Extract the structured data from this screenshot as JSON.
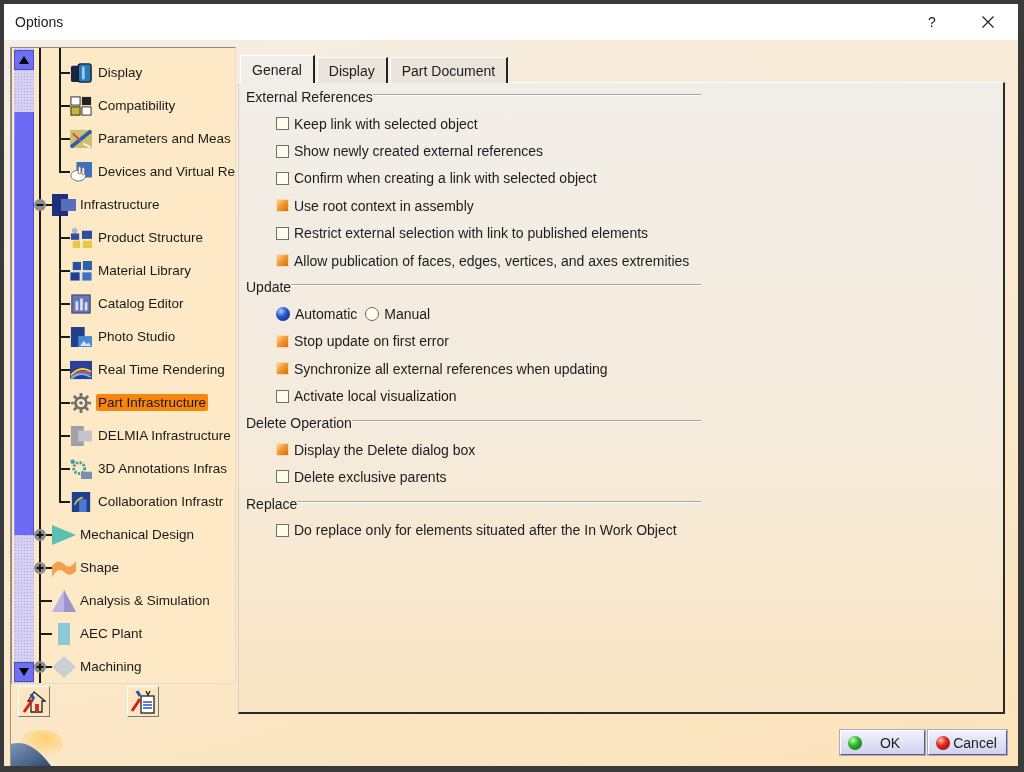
{
  "window": {
    "title": "Options",
    "help_button": "?"
  },
  "tree": {
    "scrolled_branch_children": [
      {
        "label": "Display",
        "selected": false
      },
      {
        "label": "Compatibility",
        "selected": false
      },
      {
        "label": "Parameters and Meas",
        "selected": false
      },
      {
        "label": "Devices and Virtual Re",
        "selected": false
      }
    ],
    "items": [
      {
        "label": "Infrastructure",
        "selected": false,
        "expanded": true,
        "children": [
          {
            "label": "Product Structure",
            "selected": false
          },
          {
            "label": "Material Library",
            "selected": false
          },
          {
            "label": "Catalog Editor",
            "selected": false
          },
          {
            "label": "Photo Studio",
            "selected": false
          },
          {
            "label": "Real Time Rendering",
            "selected": false
          },
          {
            "label": "Part Infrastructure",
            "selected": true
          },
          {
            "label": "DELMIA Infrastructure",
            "selected": false
          },
          {
            "label": "3D Annotations Infras",
            "selected": false
          },
          {
            "label": "Collaboration Infrastr",
            "selected": false
          }
        ]
      },
      {
        "label": "Mechanical Design",
        "selected": false,
        "expanded": false
      },
      {
        "label": "Shape",
        "selected": false,
        "expanded": false
      },
      {
        "label": "Analysis & Simulation",
        "selected": false
      },
      {
        "label": "AEC Plant",
        "selected": false
      },
      {
        "label": "Machining",
        "selected": false,
        "expanded": false
      }
    ]
  },
  "tabs": [
    {
      "label": "General",
      "selected": true
    },
    {
      "label": "Display",
      "selected": false
    },
    {
      "label": "Part Document",
      "selected": false
    }
  ],
  "groups": [
    {
      "title": "External References",
      "options": [
        {
          "kind": "checkbox",
          "label": "Keep link with selected object",
          "checked": false
        },
        {
          "kind": "checkbox",
          "label": "Show newly created external references",
          "checked": false
        },
        {
          "kind": "checkbox",
          "label": "Confirm when creating a link with selected object",
          "checked": false
        },
        {
          "kind": "checkbox",
          "label": "Use root context in assembly",
          "checked": true
        },
        {
          "kind": "checkbox",
          "label": "Restrict external selection with link to published elements",
          "checked": false
        },
        {
          "kind": "checkbox",
          "label": "Allow publication of faces, edges, vertices, and axes extremities",
          "checked": true
        }
      ]
    },
    {
      "title": "Update",
      "options": [
        {
          "kind": "radio_group",
          "choices": [
            {
              "label": "Automatic",
              "selected": true
            },
            {
              "label": "Manual",
              "selected": false
            }
          ]
        },
        {
          "kind": "checkbox",
          "label": "Stop update on first error",
          "checked": true
        },
        {
          "kind": "checkbox",
          "label": "Synchronize all external references when updating",
          "checked": true
        },
        {
          "kind": "checkbox",
          "label": "Activate local visualization",
          "checked": false
        }
      ]
    },
    {
      "title": "Delete Operation",
      "options": [
        {
          "kind": "checkbox",
          "label": "Display the Delete dialog box",
          "checked": true
        },
        {
          "kind": "checkbox",
          "label": "Delete exclusive parents",
          "checked": false
        }
      ]
    },
    {
      "title": "Replace",
      "options": [
        {
          "kind": "checkbox",
          "label": "Do replace only for elements situated after the In Work Object",
          "checked": false
        }
      ]
    }
  ],
  "buttons": [
    {
      "kind": "ok",
      "label": "OK"
    },
    {
      "kind": "cancel",
      "label": "Cancel"
    }
  ]
}
